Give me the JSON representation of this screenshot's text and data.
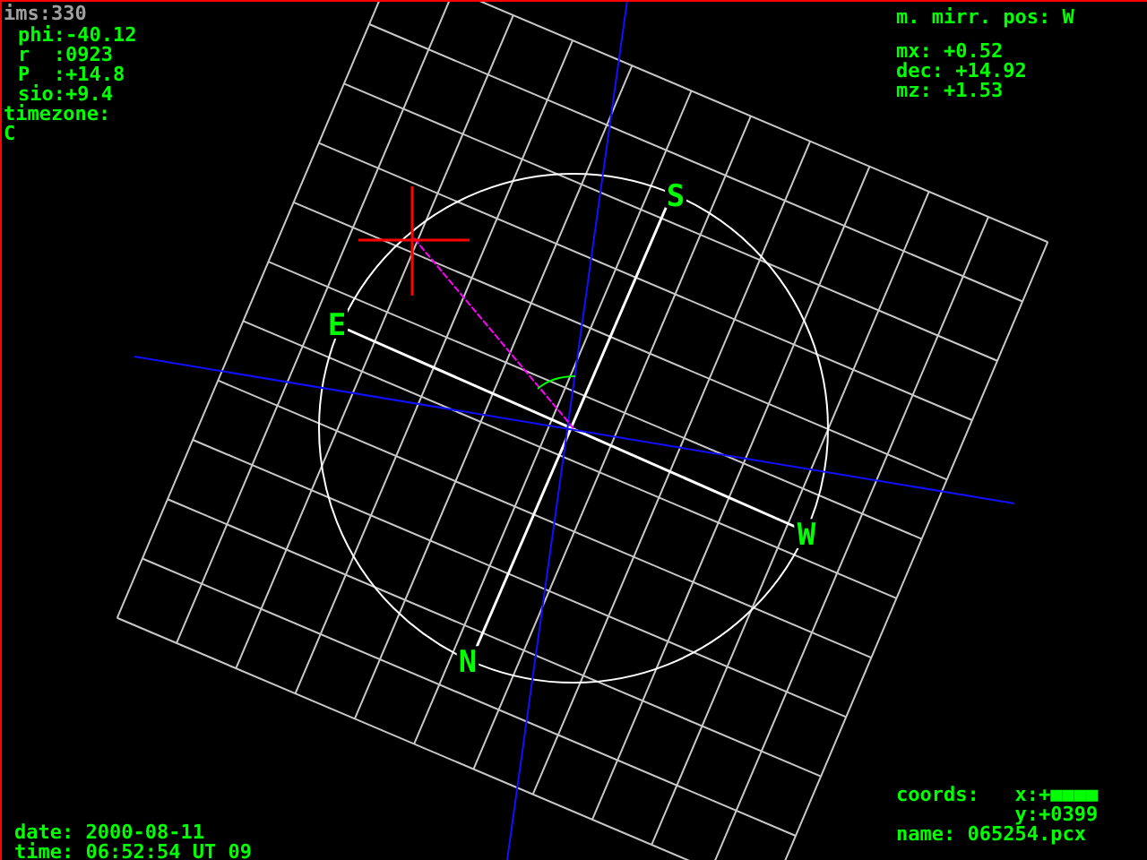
{
  "header": "ims:330",
  "readouts": [
    "phi:-40.12",
    "r  :0923",
    "P  :+14.8",
    "sio:+9.4"
  ],
  "timezone": {
    "label": "timezone:",
    "value": "C"
  },
  "mirror": {
    "label": "m. mirr. pos: W",
    "values": [
      "mx: +0.52",
      "dec: +14.92",
      "mz: +1.53"
    ]
  },
  "compass": [
    "S",
    "E",
    "W",
    "N"
  ],
  "coords": {
    "x": "coords:   x:+■■■■",
    "y": "y:+0399",
    "name": "name: 065254.pcx"
  },
  "date": "date: 2000-08-11",
  "time": "time: 06:52:54 UT 09"
}
